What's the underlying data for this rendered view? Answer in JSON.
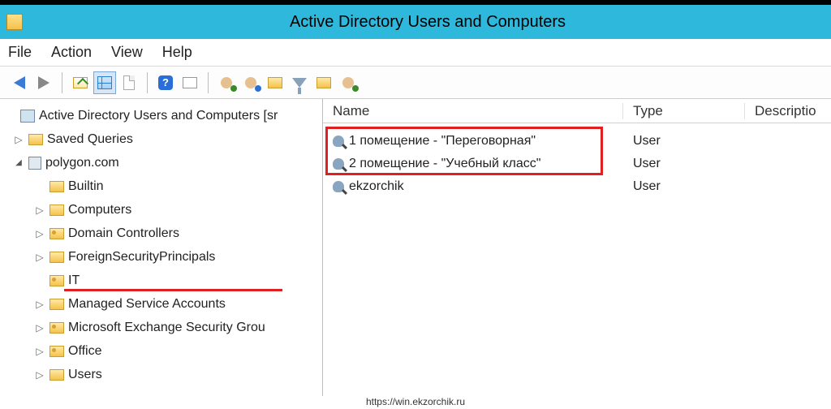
{
  "window": {
    "title": "Active Directory Users and Computers"
  },
  "menu": {
    "file": "File",
    "action": "Action",
    "view": "View",
    "help": "Help"
  },
  "tree": {
    "root": "Active Directory Users and Computers [sr",
    "saved_queries": "Saved Queries",
    "domain": "polygon.com",
    "builtin": "Builtin",
    "computers": "Computers",
    "domain_controllers": "Domain Controllers",
    "fsp": "ForeignSecurityPrincipals",
    "it": "IT",
    "msa": "Managed Service Accounts",
    "exchange": "Microsoft Exchange Security Grou",
    "office": "Office",
    "users": "Users"
  },
  "list": {
    "columns": {
      "name": "Name",
      "type": "Type",
      "description": "Descriptio"
    },
    "rows": [
      {
        "name": "1 помещение - \"Переговорная\"",
        "type": "User"
      },
      {
        "name": "2 помещение - \"Учебный класс\"",
        "type": "User"
      },
      {
        "name": "ekzorchik",
        "type": "User"
      }
    ]
  },
  "footer": {
    "url": "https://win.ekzorchik.ru"
  }
}
